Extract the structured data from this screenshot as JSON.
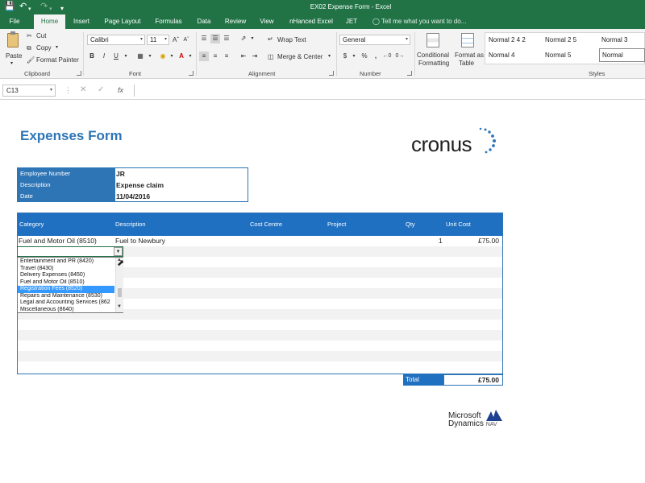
{
  "window": {
    "title": "EX02 Expense Form - Excel"
  },
  "ribbon_tabs": [
    "File",
    "Home",
    "Insert",
    "Page Layout",
    "Formulas",
    "Data",
    "Review",
    "View",
    "nHanced Excel",
    "JET"
  ],
  "tell_me": "Tell me what you want to do...",
  "clipboard": {
    "paste": "Paste",
    "cut": "Cut",
    "copy": "Copy",
    "format_painter": "Format Painter",
    "group": "Clipboard"
  },
  "font": {
    "name": "Calibri",
    "size": "11",
    "bold": "B",
    "italic": "I",
    "underline": "U",
    "group": "Font"
  },
  "alignment": {
    "wrap": "Wrap Text",
    "merge": "Merge & Center",
    "group": "Alignment"
  },
  "number": {
    "format": "General",
    "currency": "$",
    "percent": "%",
    "comma": ",",
    "group": "Number"
  },
  "styles_cmds": {
    "conditional": "Conditional",
    "formatting": "Formatting",
    "format_as": "Format as",
    "table": "Table",
    "group": "Styles"
  },
  "styles": [
    "Normal 2 4 2",
    "Normal 2 5",
    "Normal 3",
    "Normal 4",
    "Normal 5",
    "Normal"
  ],
  "formula_bar": {
    "name_box": "C13",
    "fx": "fx",
    "value": ""
  },
  "sheet": {
    "title": "Expenses Form",
    "logo": "cronus",
    "header": [
      {
        "label": "Employee Number",
        "value": "JR"
      },
      {
        "label": "Description",
        "value": "Expense claim"
      },
      {
        "label": "Date",
        "value": "11/04/2016"
      }
    ],
    "columns": [
      "Category",
      "Description",
      "Cost Centre",
      "Project",
      "Qty",
      "Unit Cost"
    ],
    "lines": [
      {
        "category": "Fuel and Motor Oil (8510)",
        "description": "Fuel to Newbury",
        "cost_centre": "",
        "project": "",
        "qty": "1",
        "unit_cost": "£75.00"
      }
    ],
    "dropdown_options": [
      "Entertainment and PR (8420)",
      "Travel (8430)",
      "Delivery Expenses (8450)",
      "Fuel and Motor Oil (8510)",
      "Registration Fees (8520)",
      "Repairs and Maintenance (8530)",
      "Legal and Accounting Services (862",
      "Miscellaneous (8640)"
    ],
    "dropdown_selected_index": 4,
    "total_label": "Total",
    "total_value": "£75.00",
    "footer_logo": {
      "line1": "Microsoft",
      "line2": "Dynamics",
      "nav": "NAV"
    }
  },
  "colors": {
    "excel_green": "#217346",
    "header_blue": "#1f70c1",
    "title_blue": "#2e75b6",
    "selected_blue": "#3399ff"
  }
}
